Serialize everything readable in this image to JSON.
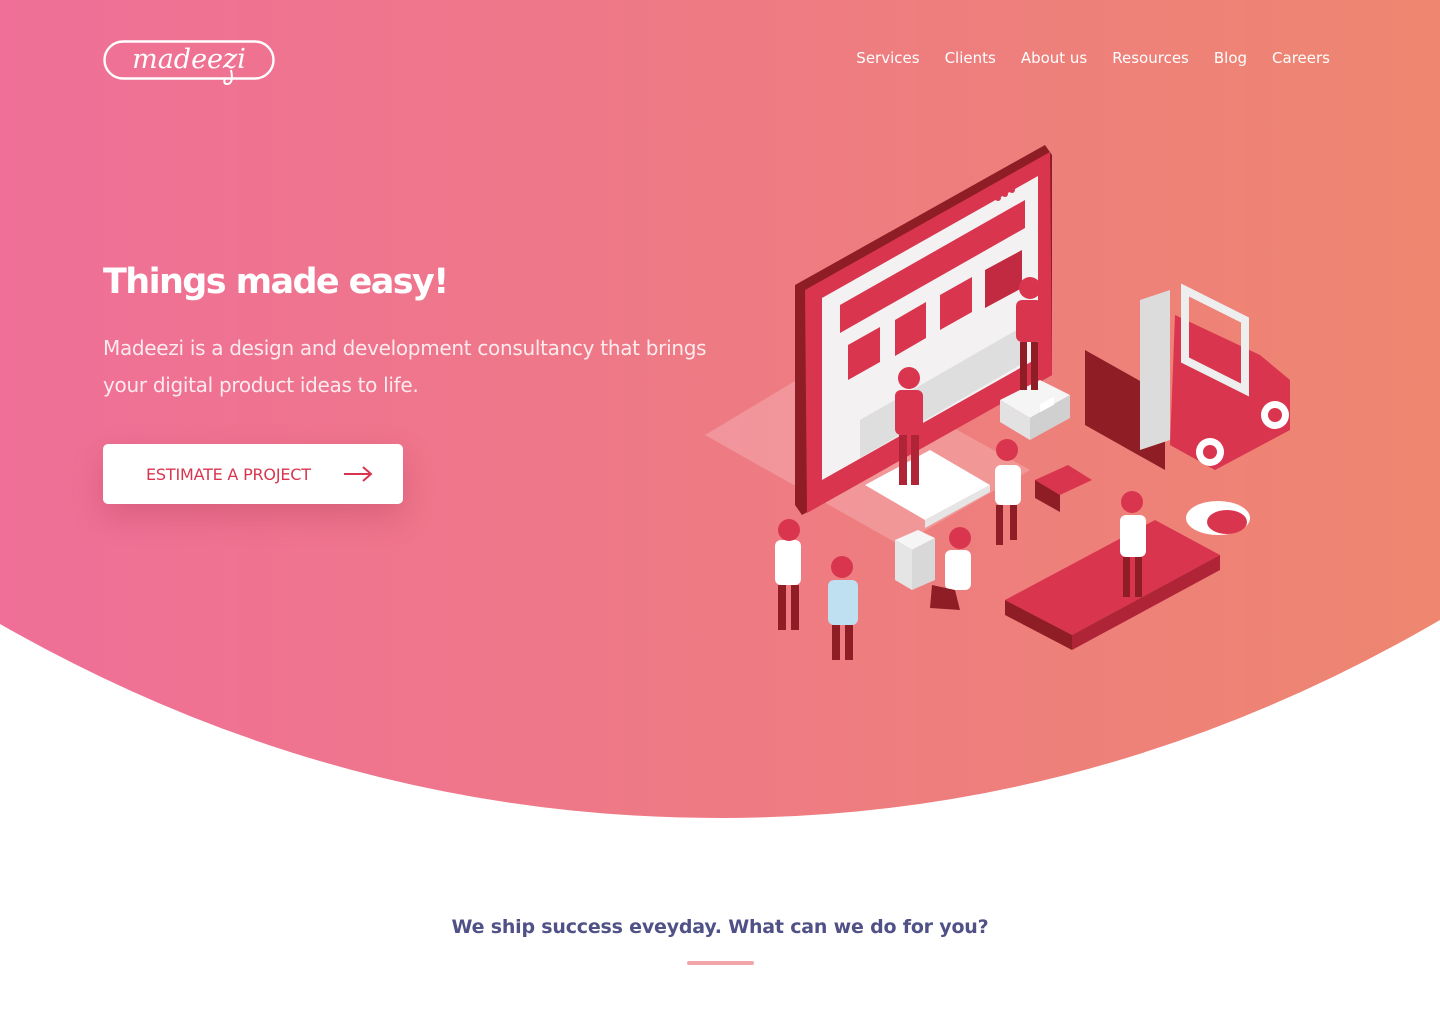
{
  "brand": {
    "logo_text": "madeezi",
    "gradient_start": "#ef6f98",
    "gradient_end": "#ee8670",
    "accent": "#d9354f"
  },
  "nav": {
    "items": [
      {
        "label": "Services"
      },
      {
        "label": "Clients"
      },
      {
        "label": "About us"
      },
      {
        "label": "Resources"
      },
      {
        "label": "Blog"
      },
      {
        "label": "Careers"
      }
    ]
  },
  "hero": {
    "headline": "Things made easy!",
    "subtext": "Madeezi is a design and development consultancy that brings your digital product ideas to life.",
    "cta_label": "ESTIMATE A PROJECT",
    "cta_icon": "arrow-right-icon",
    "illustration": "isometric-team-building-website-illustration"
  },
  "section": {
    "tagline": "We ship success eveyday. What can we do for you?"
  }
}
